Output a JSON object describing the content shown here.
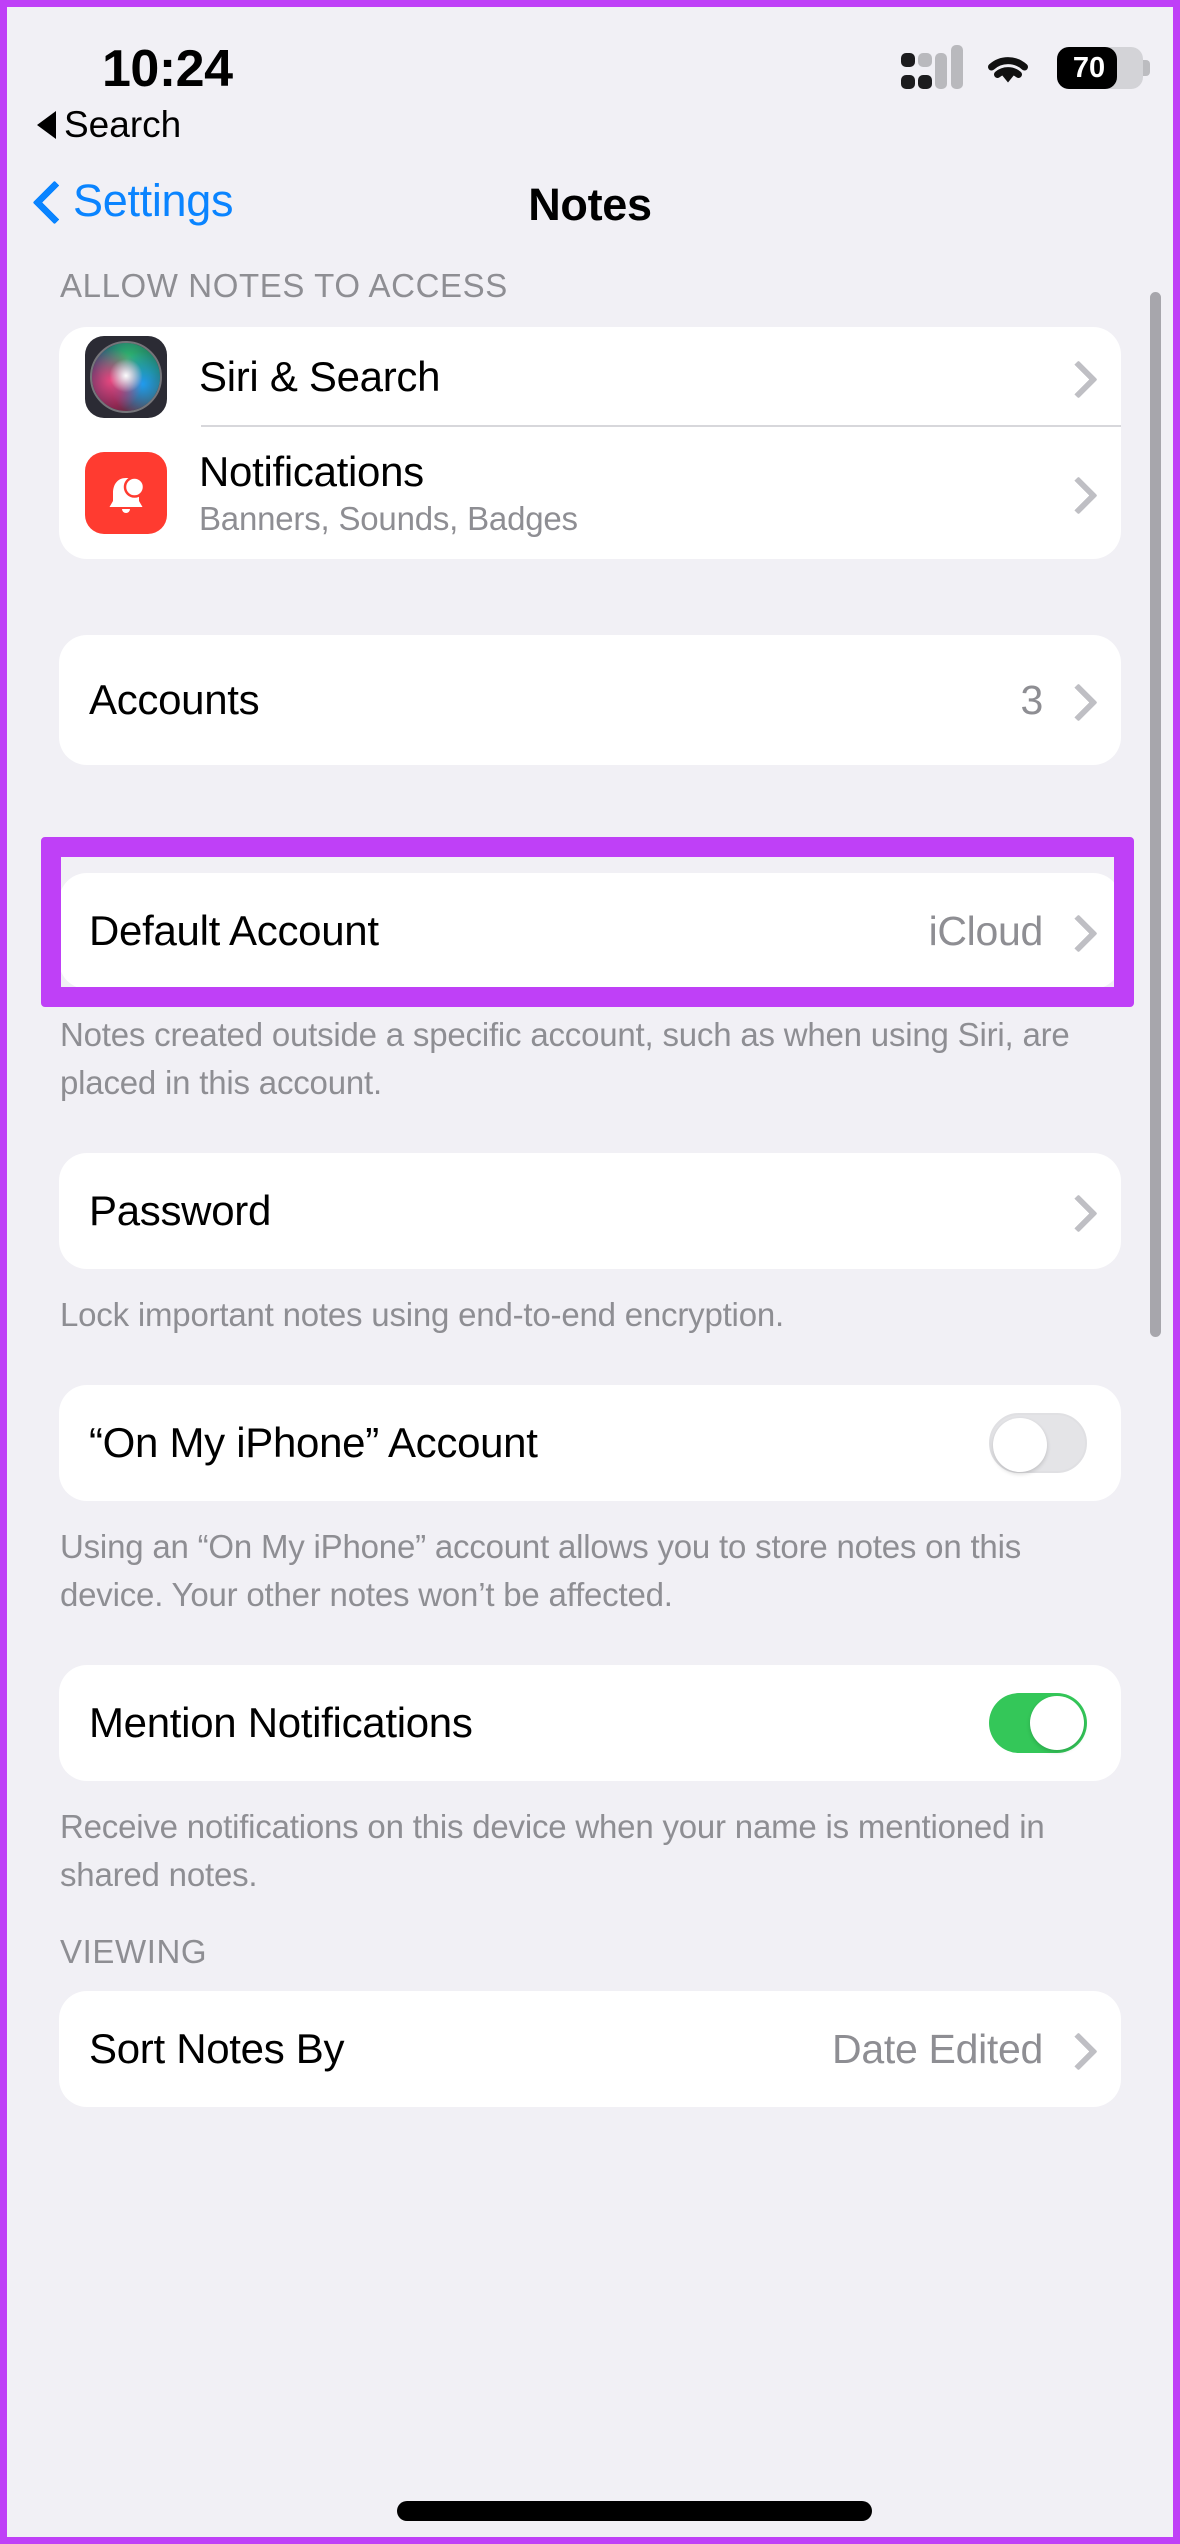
{
  "status_bar": {
    "time": "10:24",
    "back_label": "Search",
    "back_icon": "triangle-left-icon",
    "cellular_icon": "cellular-signal-icon",
    "wifi_icon": "wifi-icon",
    "battery_icon": "battery-icon",
    "battery_level": "70"
  },
  "nav_bar": {
    "back_icon": "chevron-left-icon",
    "back_label": "Settings",
    "title": "Notes"
  },
  "sections": {
    "access": {
      "header": "ALLOW NOTES TO ACCESS",
      "rows": [
        {
          "icon": "siri-icon",
          "label": "Siri & Search",
          "subtitle": "",
          "accessory": "chevron-right-icon"
        },
        {
          "icon": "notifications-bell-icon",
          "label": "Notifications",
          "subtitle": "Banners, Sounds, Badges",
          "accessory": "chevron-right-icon"
        }
      ]
    },
    "accounts": {
      "label": "Accounts",
      "value": "3",
      "accessory": "chevron-right-icon",
      "highlight_color": "#BF40F7"
    },
    "default_account": {
      "label": "Default Account",
      "value": "iCloud",
      "accessory": "chevron-right-icon",
      "footnote": "Notes created outside a specific account, such as when using Siri, are placed in this account."
    },
    "password": {
      "label": "Password",
      "accessory": "chevron-right-icon",
      "footnote": "Lock important notes using end-to-end encryption."
    },
    "on_my_iphone": {
      "label": "“On My iPhone” Account",
      "toggle_state": "off",
      "footnote": "Using an “On My iPhone” account allows you to store notes on this device. Your other notes won’t be affected."
    },
    "mention_notifications": {
      "label": "Mention Notifications",
      "toggle_state": "on",
      "toggle_on_color": "#34C759",
      "footnote": "Receive notifications on this device when your name is mentioned in shared notes."
    },
    "viewing": {
      "header": "VIEWING",
      "rows": [
        {
          "label": "Sort Notes By",
          "value": "Date Edited",
          "accessory": "chevron-right-icon"
        }
      ]
    }
  },
  "annotations": {
    "strike_color": "#000000",
    "frame_color": "#BF40F7"
  },
  "colors": {
    "page_background": "#F1F0F5",
    "card_background": "#FFFFFF",
    "accent_blue": "#0A84FF",
    "secondary_text": "#8E8E93",
    "toggle_on": "#34C759",
    "notification_icon": "#FF3B30"
  }
}
